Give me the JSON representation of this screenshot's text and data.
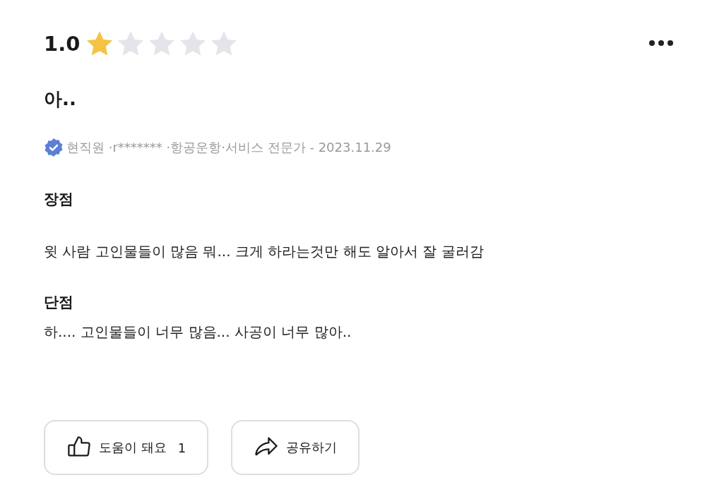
{
  "review": {
    "rating": "1.0",
    "stars": 1,
    "title": "아..",
    "meta": "현직원 ·r******* ·항공운항·서비스 전문가 - 2023.11.29",
    "sections": [
      {
        "heading": "장점",
        "body": "윗 사람 고인물들이 많음 뭐... 크게 하라는것만 해도 알아서 잘 굴러감"
      },
      {
        "heading": "단점",
        "body": "하.... 고인물들이 너무 많음... 사공이 너무 많아.."
      }
    ],
    "buttons": [
      {
        "kind": "like",
        "label": "도움이 돼요",
        "count": "1"
      },
      {
        "kind": "share",
        "label": "공유하기"
      }
    ]
  }
}
